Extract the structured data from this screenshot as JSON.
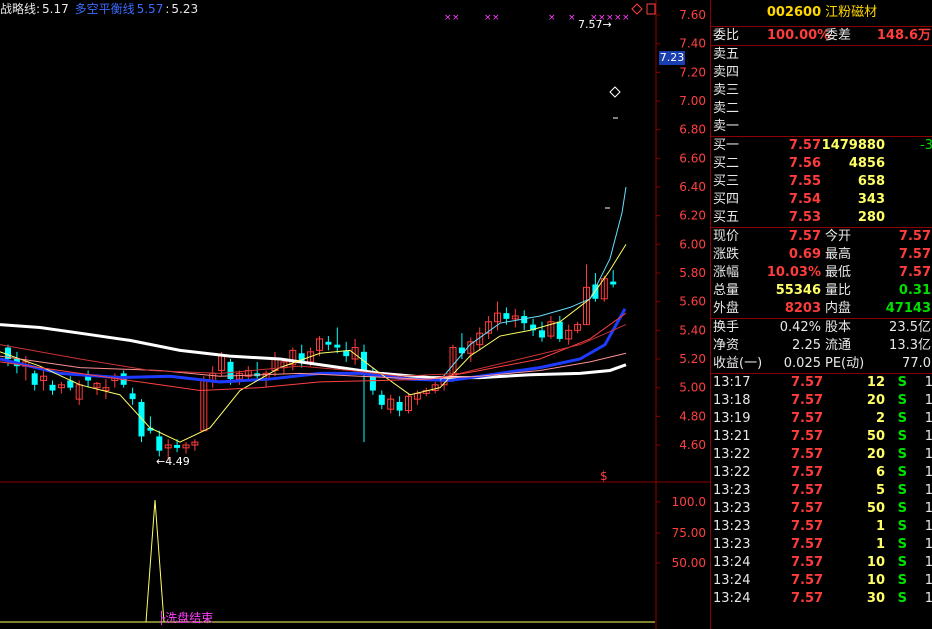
{
  "legend": {
    "strategy_label": "战略线:",
    "strategy_value": "5.17",
    "balance_label": "多空平衡线",
    "balance_value1": "5.57",
    "balance_value2": "5.23"
  },
  "chart": {
    "price_axis": [
      "7.60",
      "7.40",
      "7.20",
      "7.00",
      "6.80",
      "6.60",
      "6.40",
      "6.20",
      "6.00",
      "5.80",
      "5.60",
      "5.40",
      "5.20",
      "5.00",
      "4.80",
      "4.60"
    ],
    "current_price_tag": "7.23",
    "high_marker": "7.57",
    "low_marker": "4.49",
    "indicator_axis": [
      "100.0",
      "75.00",
      "50.00"
    ],
    "indicator_label": "洗盘结束",
    "dollar_marker": "$",
    "colors": {
      "up": "#ff3c3c",
      "down": "#00ffff",
      "ma_white": "#ffffff",
      "ma_blue": "#1e3cff",
      "ma_yellow": "#ffff66",
      "grid": "#8b0000"
    }
  },
  "quote": {
    "code": "002600",
    "name": "江粉磁材",
    "webi_label": "委比",
    "webi_value": "100.00%",
    "weicha_label": "委差",
    "weicha_value": "148.6万",
    "sell": [
      {
        "label": "卖五"
      },
      {
        "label": "卖四"
      },
      {
        "label": "卖三"
      },
      {
        "label": "卖二"
      },
      {
        "label": "卖一"
      }
    ],
    "buy": [
      {
        "label": "买一",
        "price": "7.57",
        "vol": "1479880",
        "chg": "-3"
      },
      {
        "label": "买二",
        "price": "7.56",
        "vol": "4856",
        "chg": ""
      },
      {
        "label": "买三",
        "price": "7.55",
        "vol": "658",
        "chg": ""
      },
      {
        "label": "买四",
        "price": "7.54",
        "vol": "343",
        "chg": ""
      },
      {
        "label": "买五",
        "price": "7.53",
        "vol": "280",
        "chg": ""
      }
    ],
    "stats": [
      {
        "l1": "现价",
        "v1": "7.57",
        "l2": "今开",
        "v2": "7.57",
        "c1": "red",
        "c2": "red"
      },
      {
        "l1": "涨跌",
        "v1": "0.69",
        "l2": "最高",
        "v2": "7.57",
        "c1": "red",
        "c2": "red"
      },
      {
        "l1": "涨幅",
        "v1": "10.03%",
        "l2": "最低",
        "v2": "7.57",
        "c1": "red",
        "c2": "red"
      },
      {
        "l1": "总量",
        "v1": "55346",
        "l2": "量比",
        "v2": "0.31",
        "c1": "yel",
        "c2": "grn"
      },
      {
        "l1": "外盘",
        "v1": "8203",
        "l2": "内盘",
        "v2": "47143",
        "c1": "red",
        "c2": "grn"
      }
    ],
    "stats2": [
      {
        "l1": "换手",
        "v1": "0.42%",
        "l2": "股本",
        "v2": "23.5亿"
      },
      {
        "l1": "净资",
        "v1": "2.25",
        "l2": "流通",
        "v2": "13.3亿"
      },
      {
        "l1": "收益(一)",
        "v1": "0.025",
        "l2": "PE(动)",
        "v2": "77.0"
      }
    ],
    "ticks": [
      {
        "t": "13:17",
        "p": "7.57",
        "v": "12",
        "s": "S",
        "n": "1"
      },
      {
        "t": "13:18",
        "p": "7.57",
        "v": "20",
        "s": "S",
        "n": "1"
      },
      {
        "t": "13:19",
        "p": "7.57",
        "v": "2",
        "s": "S",
        "n": "1"
      },
      {
        "t": "13:21",
        "p": "7.57",
        "v": "50",
        "s": "S",
        "n": "1"
      },
      {
        "t": "13:22",
        "p": "7.57",
        "v": "20",
        "s": "S",
        "n": "1"
      },
      {
        "t": "13:22",
        "p": "7.57",
        "v": "6",
        "s": "S",
        "n": "1"
      },
      {
        "t": "13:23",
        "p": "7.57",
        "v": "5",
        "s": "S",
        "n": "1"
      },
      {
        "t": "13:23",
        "p": "7.57",
        "v": "50",
        "s": "S",
        "n": "1"
      },
      {
        "t": "13:23",
        "p": "7.57",
        "v": "1",
        "s": "S",
        "n": "1"
      },
      {
        "t": "13:23",
        "p": "7.57",
        "v": "1",
        "s": "S",
        "n": "1"
      },
      {
        "t": "13:24",
        "p": "7.57",
        "v": "10",
        "s": "S",
        "n": "1"
      },
      {
        "t": "13:24",
        "p": "7.57",
        "v": "10",
        "s": "S",
        "n": "1"
      },
      {
        "t": "13:24",
        "p": "7.57",
        "v": "30",
        "s": "S",
        "n": "1"
      }
    ]
  }
}
